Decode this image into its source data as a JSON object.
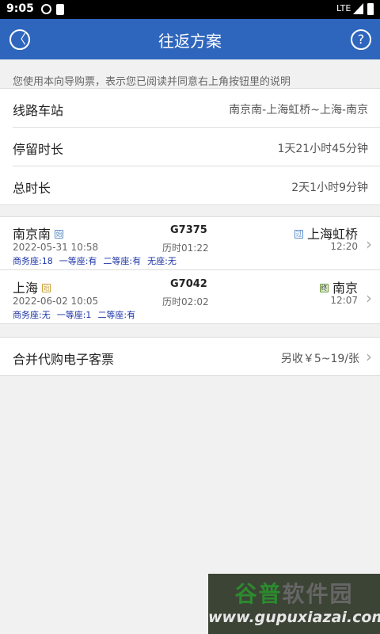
{
  "status": {
    "time": "9:05",
    "network": "LTE"
  },
  "header": {
    "title": "往返方案",
    "back_glyph": "〈",
    "help_glyph": "?"
  },
  "notice": "您使用本向导购票，表示您已阅读并同意右上角按钮里的说明",
  "info": [
    {
      "label": "线路车站",
      "value": "南京南-上海虹桥~上海-南京"
    },
    {
      "label": "停留时长",
      "value": "1天21小时45分钟"
    },
    {
      "label": "总时长",
      "value": "2天1小时9分钟"
    }
  ],
  "trips": [
    {
      "from": "南京南",
      "from_icon": "始",
      "to": "上海虹桥",
      "to_icon": "过",
      "train": "G7375",
      "depart": "2022-05-31 10:58",
      "duration": "历时01:22",
      "arrive": "12:20",
      "seats": [
        "商务座:18",
        "一等座:有",
        "二等座:有",
        "无座:无"
      ]
    },
    {
      "from": "上海",
      "from_icon": "始",
      "to": "南京",
      "to_icon": "终",
      "train": "G7042",
      "depart": "2022-06-02 10:05",
      "duration": "历时02:02",
      "arrive": "12:07",
      "seats": [
        "商务座:无",
        "一等座:1",
        "二等座:有"
      ]
    }
  ],
  "merge": {
    "label": "合并代购电子客票",
    "value": "另收￥5~19/张"
  },
  "watermark": {
    "line1a": "谷普",
    "line1b": "软件园",
    "line2": "www.gupuxiazai.com"
  },
  "icons": {
    "chevron": "›"
  }
}
